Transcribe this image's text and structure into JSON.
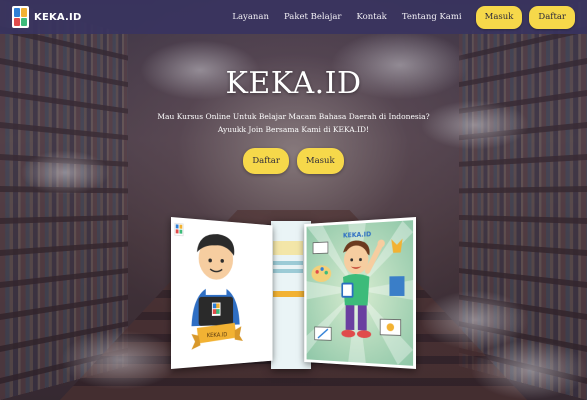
{
  "brand": {
    "name": "KEKA.ID",
    "logo_colors": [
      "#2f7fd6",
      "#f2b233",
      "#e04b4b",
      "#3dbb7a"
    ]
  },
  "nav": {
    "links": [
      "Layanan",
      "Paket Belajar",
      "Kontak",
      "Tentang Kami"
    ],
    "masuk_label": "Masuk",
    "daftar_label": "Daftar"
  },
  "hero": {
    "title": "KEKA.ID",
    "subtitle_line1": "Mau Kursus Online Untuk Belajar Macam Bahasa Daerah di Indonesia?",
    "subtitle_line2": "Ayuukk Join Bersama Kami di KEKA.ID!",
    "daftar_label": "Daftar",
    "masuk_label": "Masuk"
  },
  "cards": {
    "left_badge": "KEKA.ID",
    "right_title": "KEKA.ID"
  },
  "colors": {
    "navbar": "#3a3460",
    "button": "#f6d84a",
    "button_text": "#2d2a3a"
  }
}
